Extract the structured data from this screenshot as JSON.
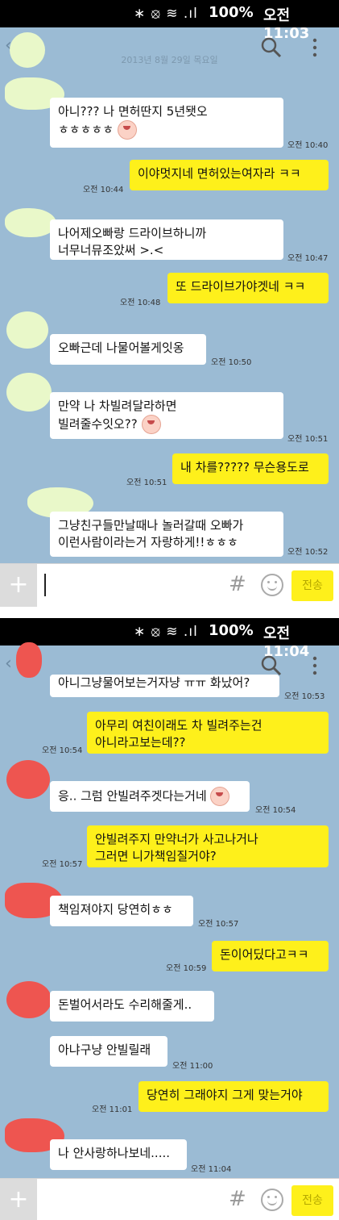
{
  "status_bar": {
    "icons": "∗ ⦻ ≋ .ıl",
    "battery": "100%",
    "clock_1": "오전 11:03",
    "clock_2": "오전 11:04"
  },
  "date_separator": "2013년 8월 29일 목요일",
  "input": {
    "hash": "#",
    "send_label": "전송"
  },
  "colors": {
    "chat_background": "#9bbbd4",
    "outgoing_bubble": "#fef01b",
    "incoming_bubble": "#ffffff"
  },
  "messages_1": [
    {
      "text": "아니??? 나 면허딴지 5년됏오\nㅎㅎㅎㅎㅎ",
      "time": "오전 10:40"
    },
    {
      "text": "이야멋지네 면허있는여자라 ㅋㅋ",
      "time": "오전 10:44"
    },
    {
      "text": "나어제오빠랑 드라이브하니까\n너무너뮤조았써 >.<",
      "time": "오전 10:47"
    },
    {
      "text": "또 드라이브가야겟네 ㅋㅋ",
      "time": "오전 10:48"
    },
    {
      "text": "오빠근데 나물어볼게잇옹",
      "time": "오전 10:50"
    },
    {
      "text": "만약 나 차빌려달라하면\n빌려줄수잇오??",
      "time": "오전 10:51"
    },
    {
      "text": "내 차를????? 무슨용도로",
      "time": "오전 10:51"
    },
    {
      "text": "그냥친구들만날때나 놀러갈때 오빠가\n이런사람이라는거 자랑하게!!ㅎㅎㅎ",
      "time": "오전 10:52"
    }
  ],
  "messages_2": [
    {
      "text": "아니그냥물어보는거자냥 ㅠㅠ 화났어?",
      "time": "오전 10:53"
    },
    {
      "text": "아무리 여친이래도 차 빌려주는건\n아니라고보는데??",
      "time": "오전 10:54"
    },
    {
      "text": "응.. 그럼 안빌려주겟다는거네",
      "time": "오전 10:54"
    },
    {
      "text": "안빌려주지 만약너가 사고나거나\n그러면 니가책임질거야?",
      "time": "오전 10:57"
    },
    {
      "text": "책임져야지 당연히ㅎㅎ",
      "time": "오전 10:57"
    },
    {
      "text": "돈이어딨다고ㅋㅋ",
      "time": "오전 10:59"
    },
    {
      "text": "돈벌어서라도 수리해줄게..",
      "time": ""
    },
    {
      "text": "아냐구냥 안빌릴래",
      "time": "오전 11:00"
    },
    {
      "text": "당연히 그래야지 그게 맞는거야",
      "time": "오전 11:01"
    },
    {
      "text": "나 안사랑하나보네.....",
      "time": "오전 11:04"
    }
  ]
}
